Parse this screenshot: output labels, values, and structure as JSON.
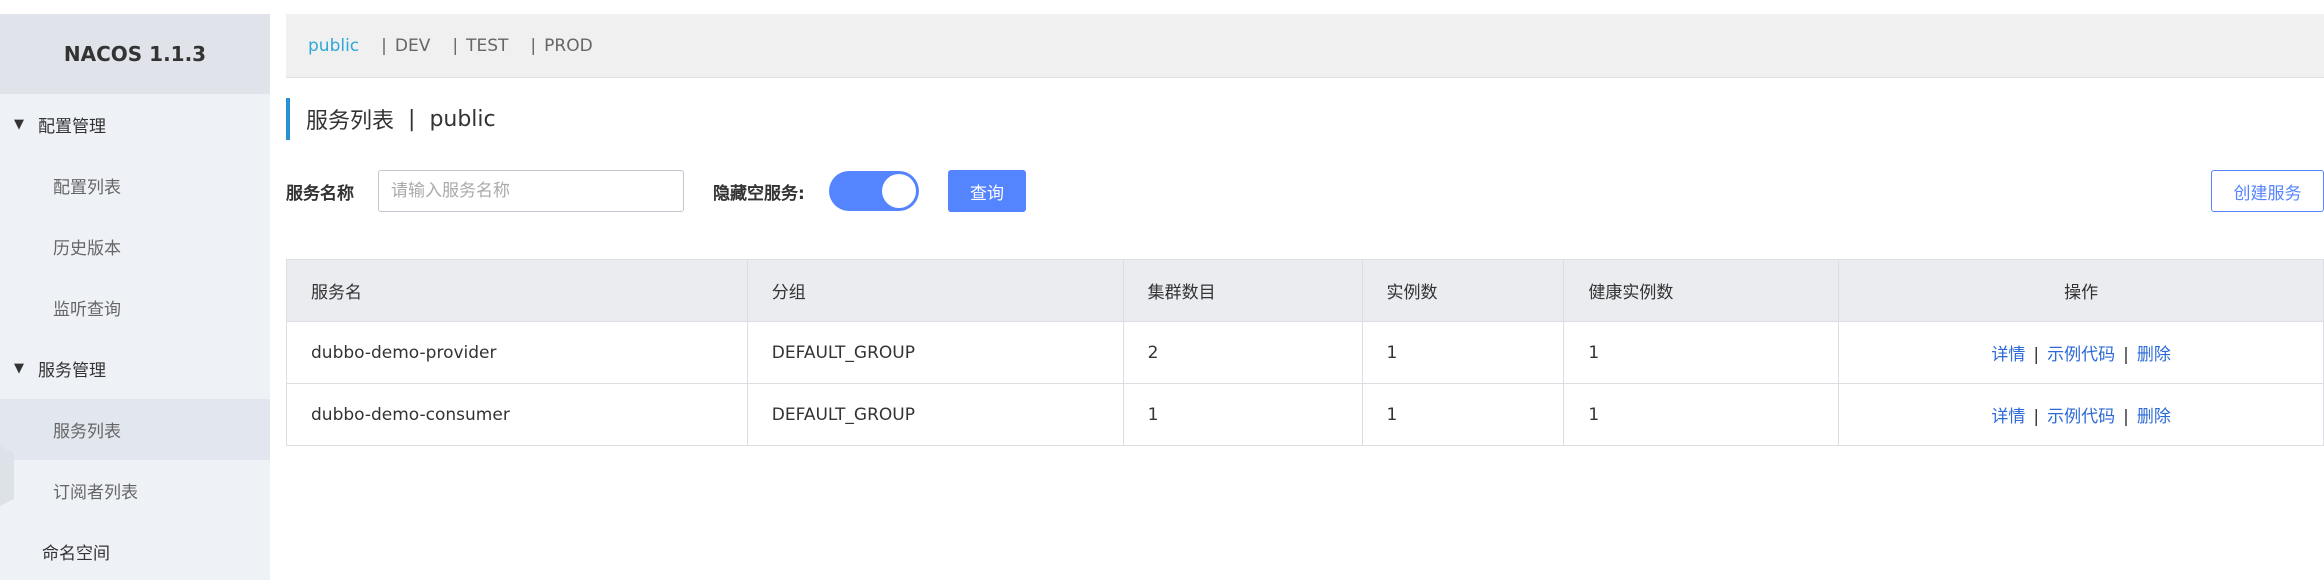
{
  "sidebar": {
    "brand": "NACOS 1.1.3",
    "config_group": "配置管理",
    "config_items": [
      "配置列表",
      "历史版本",
      "监听查询"
    ],
    "service_group": "服务管理",
    "service_items": [
      "服务列表",
      "订阅者列表"
    ],
    "namespace": "命名空间",
    "active_item": "服务列表"
  },
  "namespaces": {
    "items": [
      "public",
      "DEV",
      "TEST",
      "PROD"
    ],
    "active": "public"
  },
  "page": {
    "title": "服务列表",
    "namespace": "public"
  },
  "filter": {
    "name_label": "服务名称",
    "name_placeholder": "请输入服务名称",
    "name_value": "",
    "hide_empty_label": "隐藏空服务:",
    "hide_empty_on": true,
    "query_button": "查询",
    "create_button": "创建服务"
  },
  "table": {
    "headers": [
      "服务名",
      "分组",
      "集群数目",
      "实例数",
      "健康实例数",
      "操作"
    ],
    "rows": [
      {
        "name": "dubbo-demo-provider",
        "group": "DEFAULT_GROUP",
        "clusters": "2",
        "instances": "1",
        "healthy": "1"
      },
      {
        "name": "dubbo-demo-consumer",
        "group": "DEFAULT_GROUP",
        "clusters": "1",
        "instances": "1",
        "healthy": "1"
      }
    ],
    "actions": {
      "detail": "详情",
      "sample": "示例代码",
      "delete": "删除"
    }
  },
  "colors": {
    "primary": "#5584ff",
    "namespace_active": "#2fa8d8",
    "link": "#2b6ad6",
    "title_accent": "#2b8fd6"
  }
}
